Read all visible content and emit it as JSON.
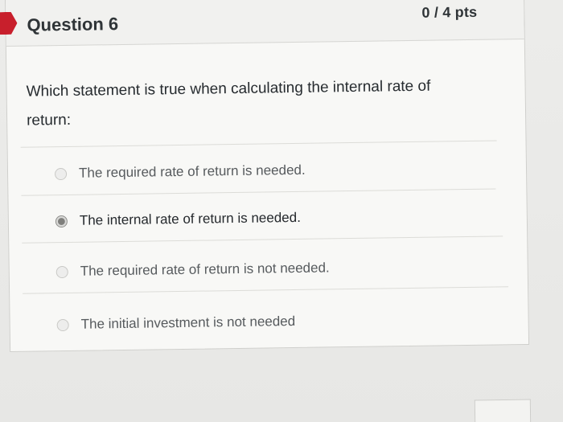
{
  "question": {
    "title": "Question 6",
    "points": "0 / 4 pts",
    "text": "Which statement is true when calculating the internal rate of return:",
    "selected_index": 1,
    "answers": [
      "The required rate of return is needed.",
      "The internal rate of return is needed.",
      "The required rate of return is not needed.",
      "The initial investment is not needed"
    ]
  },
  "colors": {
    "accent_flag": "#c81f2c",
    "text_primary": "#25292d",
    "text_secondary": "#575b5e"
  }
}
